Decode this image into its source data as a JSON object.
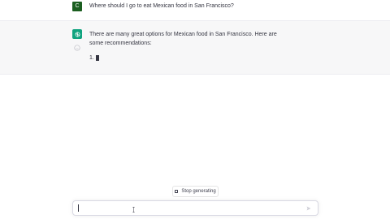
{
  "conversation": {
    "user": {
      "avatar_letter": "C",
      "avatar_color": "#1b5e20",
      "message": "Where should I go to eat Mexican food in San Francisco?"
    },
    "assistant": {
      "avatar_icon": "openai-logo-icon",
      "avatar_color": "#10a37f",
      "message": "There are many great options for Mexican food in San Francisco. Here are some recommendations:",
      "streaming_text": "1."
    }
  },
  "controls": {
    "stop_label": "Stop generating",
    "input_value": "",
    "input_placeholder": "",
    "send_icon": "send-icon"
  }
}
